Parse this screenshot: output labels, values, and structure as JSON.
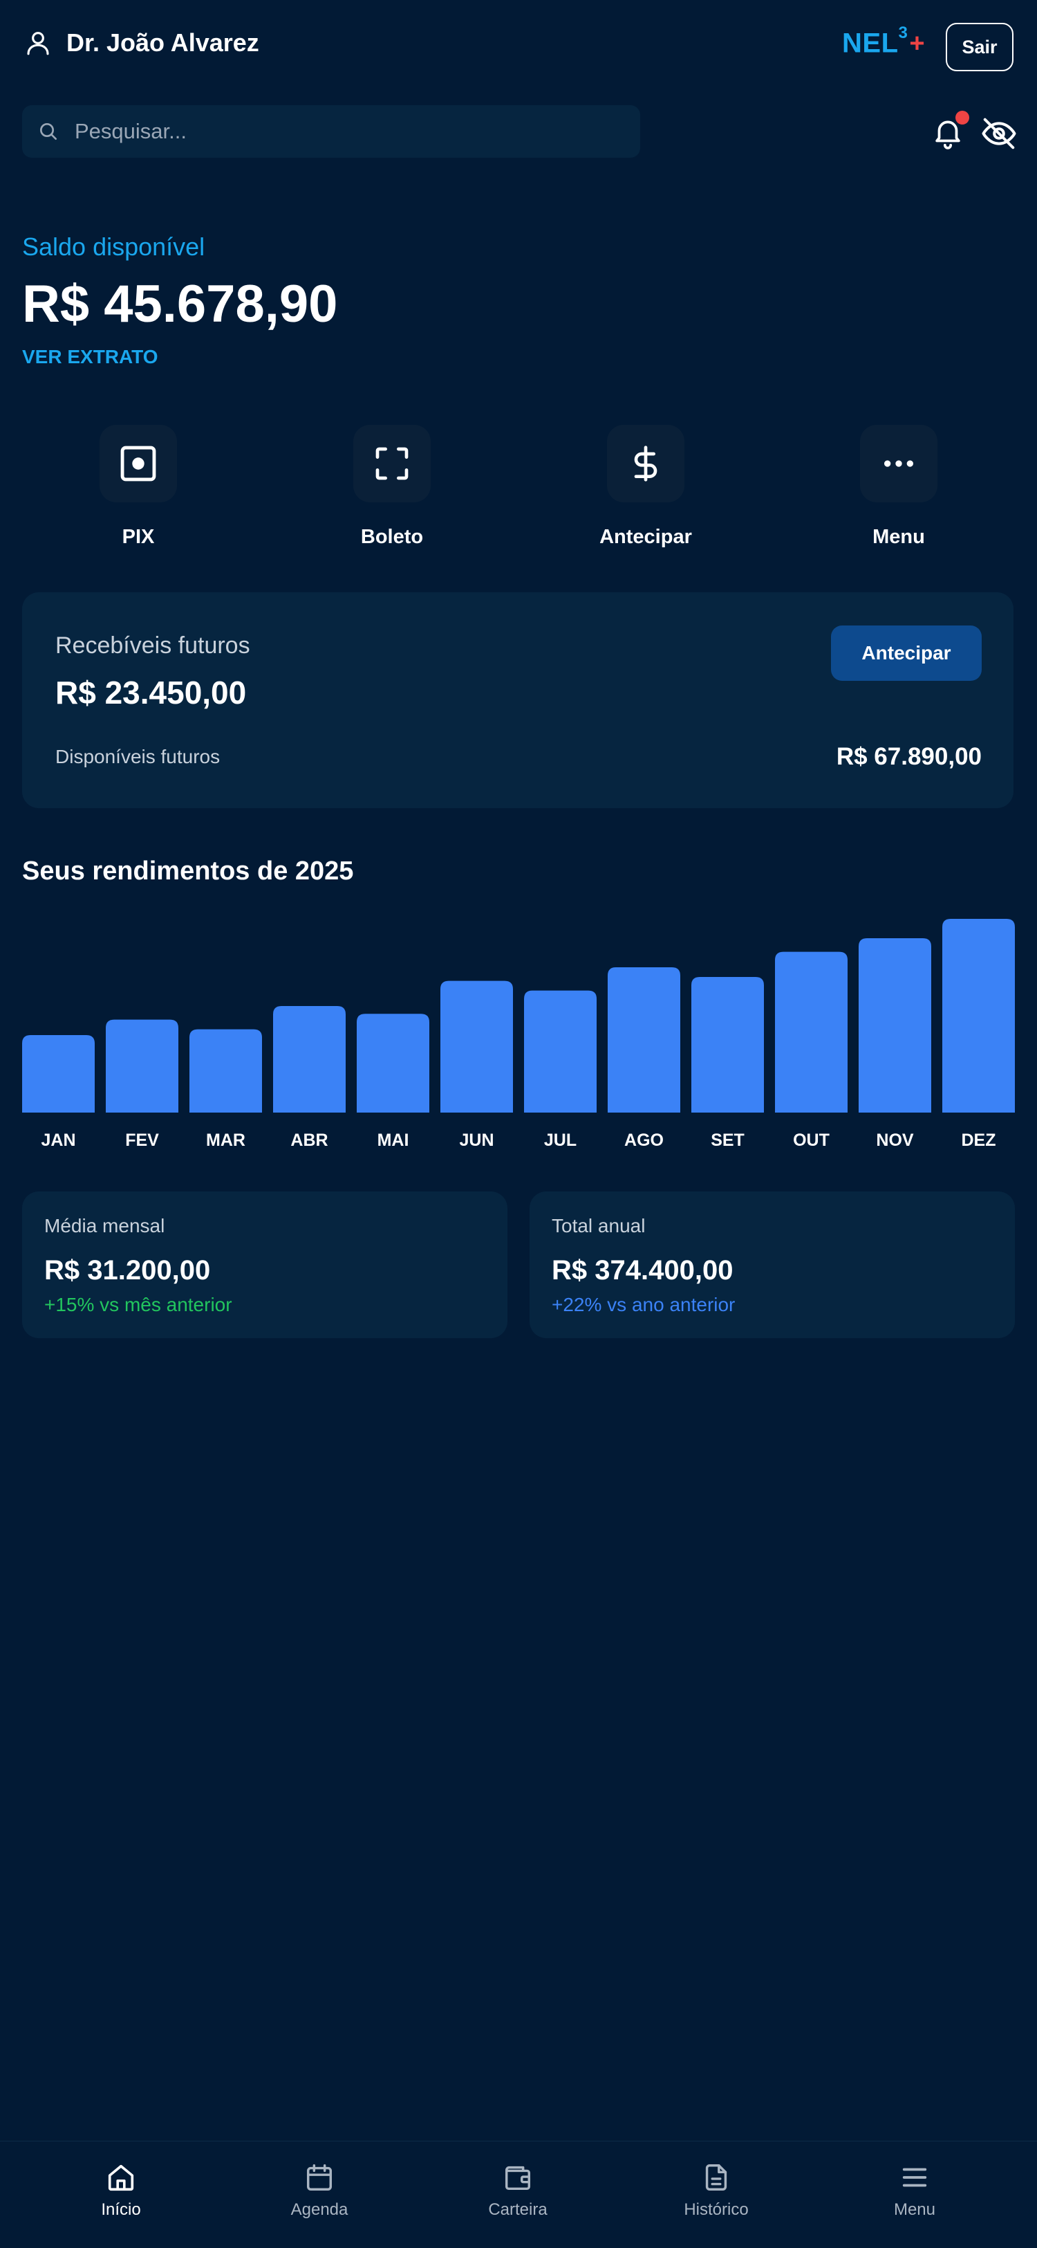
{
  "header": {
    "user_name": "Dr. João Alvarez",
    "logo_text": "NEL",
    "logo_sup": "3",
    "logo_plus": "+",
    "logout_label": "Sair"
  },
  "search": {
    "placeholder": "Pesquisar..."
  },
  "balance": {
    "label": "Saldo disponível",
    "value": "R$ 45.678,90",
    "statement_link": "VER EXTRATO"
  },
  "quick_actions": [
    {
      "label": "PIX",
      "icon": "pix-icon"
    },
    {
      "label": "Boleto",
      "icon": "scan-icon"
    },
    {
      "label": "Antecipar",
      "icon": "dollar-icon"
    },
    {
      "label": "Menu",
      "icon": "more-icon"
    }
  ],
  "receivables": {
    "title": "Recebíveis futuros",
    "value": "R$ 23.450,00",
    "button_label": "Antecipar",
    "future_label": "Disponíveis futuros",
    "future_value": "R$ 67.890,00"
  },
  "earnings": {
    "title": "Seus rendimentos de 2025"
  },
  "chart_data": {
    "type": "bar",
    "title": "Seus rendimentos de 2025",
    "categories": [
      "JAN",
      "FEV",
      "MAR",
      "ABR",
      "MAI",
      "JUN",
      "JUL",
      "AGO",
      "SET",
      "OUT",
      "NOV",
      "DEZ"
    ],
    "values": [
      0.4,
      0.48,
      0.43,
      0.55,
      0.51,
      0.68,
      0.63,
      0.75,
      0.7,
      0.83,
      0.9,
      1.0
    ],
    "ylim": [
      0,
      1
    ],
    "grid": false,
    "bar_color": "#3b82f6"
  },
  "stats": {
    "monthly": {
      "label": "Média mensal",
      "value": "R$ 31.200,00",
      "note": "+15% vs mês anterior",
      "note_color": "#22c55e"
    },
    "annual": {
      "label": "Total anual",
      "value": "R$ 374.400,00",
      "note": "+22% vs ano anterior",
      "note_color": "#3b82f6"
    }
  },
  "nav": [
    {
      "label": "Início",
      "icon": "home-icon",
      "active": true
    },
    {
      "label": "Agenda",
      "icon": "calendar-icon",
      "active": false
    },
    {
      "label": "Carteira",
      "icon": "wallet-icon",
      "active": false
    },
    {
      "label": "Histórico",
      "icon": "document-icon",
      "active": false
    },
    {
      "label": "Menu",
      "icon": "menu-icon",
      "active": false
    }
  ],
  "colors": {
    "background": "#021a35",
    "card": "#062540",
    "accent": "#1aa7ee",
    "bar": "#3b82f6",
    "notification": "#ef4444"
  }
}
